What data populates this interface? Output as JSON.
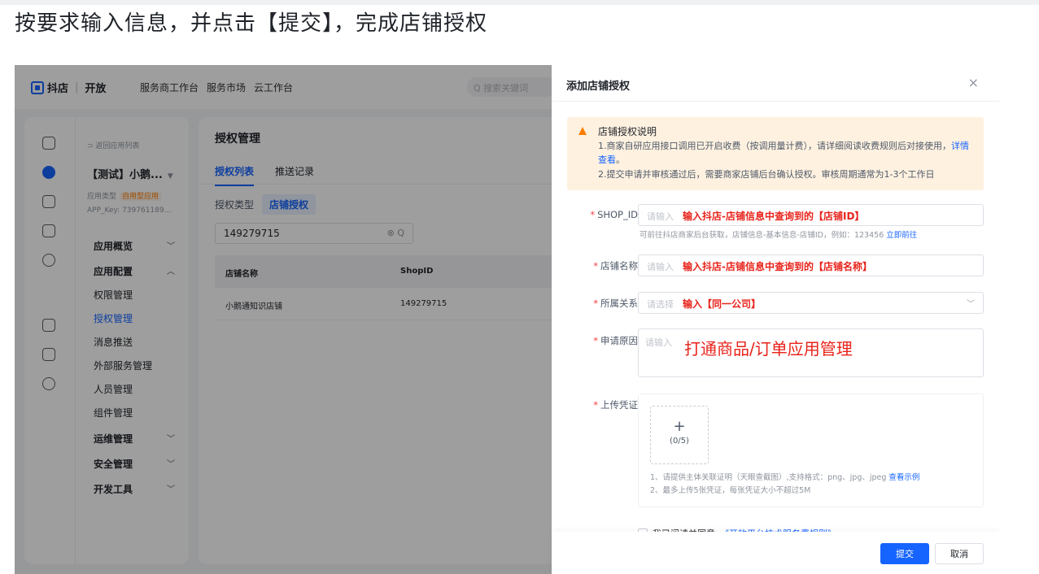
{
  "instruction": "按要求输入信息，并点击【提交】，完成店铺授权",
  "topbar": {
    "logo_text": "抖店",
    "logo_sep": "|",
    "logo_sub": "开放",
    "nav": [
      "服务商工作台",
      "服务市场",
      "云工作台"
    ],
    "search_placeholder": "Q 搜索关键词"
  },
  "sidebar": {
    "back_label": "⊃ 返回应用列表",
    "app_name": "【测试】小鹅...",
    "app_type_label": "应用类型",
    "app_type_badge": "自用型应用",
    "app_key": "APP_Key: 739761189...",
    "items": [
      {
        "label": "应用概览",
        "arrow": "﹀"
      },
      {
        "label": "应用配置",
        "arrow": "︿"
      },
      {
        "label": "权限管理"
      },
      {
        "label": "授权管理"
      },
      {
        "label": "消息推送"
      },
      {
        "label": "外部服务管理"
      },
      {
        "label": "人员管理"
      },
      {
        "label": "组件管理"
      },
      {
        "label": "运维管理",
        "arrow": "﹀"
      },
      {
        "label": "安全管理",
        "arrow": "﹀"
      },
      {
        "label": "开发工具",
        "arrow": "﹀"
      }
    ]
  },
  "main": {
    "title": "授权管理",
    "tabs": [
      "授权列表",
      "推送记录"
    ],
    "auth_type_label": "授权类型",
    "auth_type_chip": "店铺授权",
    "search_value": "149279715",
    "search_tools": "⊗ Q",
    "table": {
      "headers": [
        "店铺名称",
        "ShopID"
      ],
      "rows": [
        [
          "小鹅通知识店铺",
          "149279715"
        ]
      ]
    }
  },
  "drawer": {
    "title": "添加店铺授权",
    "close": "×",
    "notice": {
      "title": "店铺授权说明",
      "line1_a": "1.商家自研应用接口调用已开启收费（按调用量计费），请详细阅读收费规则后对接使用，",
      "line1_link": "详情查看",
      "line1_b": "。",
      "line2": "2.提交申请并审核通过后，需要商家店铺后台确认授权。审核周期通常为1-3个工作日"
    },
    "fields": {
      "shop_id": {
        "label": "SHOP_ID",
        "placeholder": "请输入",
        "annotation": "输入抖店-店铺信息中查询到的【店铺ID】",
        "hint": "可前往抖店商家后台获取，店铺信息-基本信息-店铺ID，例如：123456 ",
        "hint_link": "立即前往"
      },
      "shop_name": {
        "label": "店铺名称",
        "placeholder": "请输入",
        "annotation": "输入抖店-店铺信息中查询到的【店铺名称】"
      },
      "relation": {
        "label": "所属关系",
        "placeholder": "请选择",
        "annotation": "输入【同一公司】",
        "chevron": "﹀"
      },
      "reason": {
        "label": "申请原因",
        "placeholder": "请输入",
        "annotation": "打通商品/订单应用管理"
      },
      "upload": {
        "label": "上传凭证",
        "plus": "+",
        "count": "(0/5)",
        "tip1": "1、请提供主体关联证明（天眼查截图）,支持格式：png、jpg、jpeg ",
        "tip1_link": "查看示例",
        "tip2": "2、最多上传5张凭证，每张凭证大小不超过5M"
      }
    },
    "agree_text": "我已阅读并同意",
    "agree_link": "《开放平台技术服务费规则》",
    "submit_label": "提交",
    "cancel_label": "取消"
  },
  "colors": {
    "primary": "#1664ff",
    "annotation_red": "#e8231b",
    "warning_bg": "#fff1e0",
    "warning_icon": "#ff7d00"
  }
}
